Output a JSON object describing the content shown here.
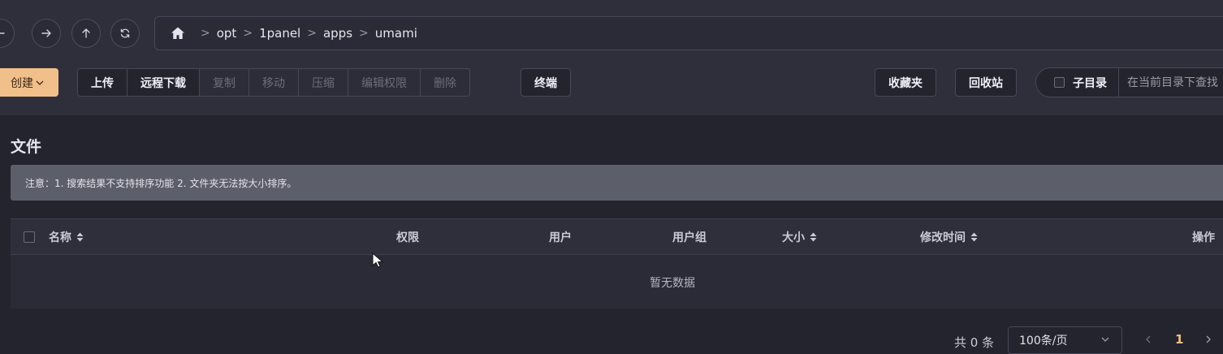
{
  "nav": {
    "back_icon": "arrow-left-icon",
    "forward_icon": "arrow-right-icon",
    "up_icon": "arrow-up-icon",
    "refresh_icon": "refresh-icon"
  },
  "path": {
    "home_icon": "home-icon",
    "separator": ">",
    "crumbs": [
      "opt",
      "1panel",
      "apps",
      "umami"
    ]
  },
  "toolbar": {
    "create_label": "创建",
    "upload_label": "上传",
    "remote_download_label": "远程下载",
    "copy_label": "复制",
    "move_label": "移动",
    "compress_label": "压缩",
    "edit_permission_label": "编辑权限",
    "delete_label": "删除",
    "terminal_label": "终端",
    "favorites_label": "收藏夹",
    "recycle_bin_label": "回收站",
    "subdir_label": "子目录",
    "search_placeholder": "在当前目录下查找"
  },
  "section": {
    "title": "文件",
    "notice": "注意：1. 搜索结果不支持排序功能 2. 文件夹无法按大小排序。"
  },
  "table": {
    "columns": {
      "name": "名称",
      "permission": "权限",
      "user": "用户",
      "group": "用户组",
      "size": "大小",
      "modified": "修改时间",
      "actions": "操作"
    },
    "empty_text": "暂无数据"
  },
  "pagination": {
    "total": "共 0 条",
    "page_size": "100条/页",
    "current_page": "1"
  },
  "colors": {
    "accent": "#f1bf8a",
    "background": "#23242e",
    "toolbar_bg": "#2e2f3b",
    "notice_bg": "#5c5e6a"
  }
}
